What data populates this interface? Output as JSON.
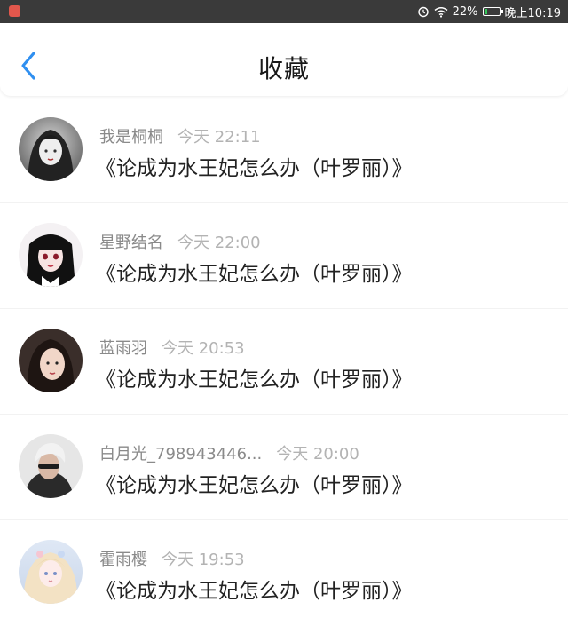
{
  "status_bar": {
    "app_icon": "app-notification-icon",
    "alarm_icon": "alarm-icon",
    "wifi_icon": "wifi-icon",
    "battery_percent": "22%",
    "battery_level": 0.22,
    "time": "晚上10:19"
  },
  "header": {
    "back_icon": "chevron-left-icon",
    "title": "收藏"
  },
  "colors": {
    "accent": "#2f8ff0",
    "name": "#8a8a8a",
    "time": "#b3b3b3",
    "content": "#222222"
  },
  "items": [
    {
      "name": "我是桐桐",
      "time": "今天 22:11",
      "content": "《论成为水王妃怎么办（叶罗丽）》"
    },
    {
      "name": "星野结名",
      "time": "今天 22:00",
      "content": "《论成为水王妃怎么办（叶罗丽）》"
    },
    {
      "name": "蓝雨羽",
      "time": "今天 20:53",
      "content": "《论成为水王妃怎么办（叶罗丽）》"
    },
    {
      "name": "白月光_798943446...",
      "time": "今天 20:00",
      "content": "《论成为水王妃怎么办（叶罗丽）》"
    },
    {
      "name": "霍雨樱",
      "time": "今天 19:53",
      "content": "《论成为水王妃怎么办（叶罗丽）》"
    }
  ]
}
